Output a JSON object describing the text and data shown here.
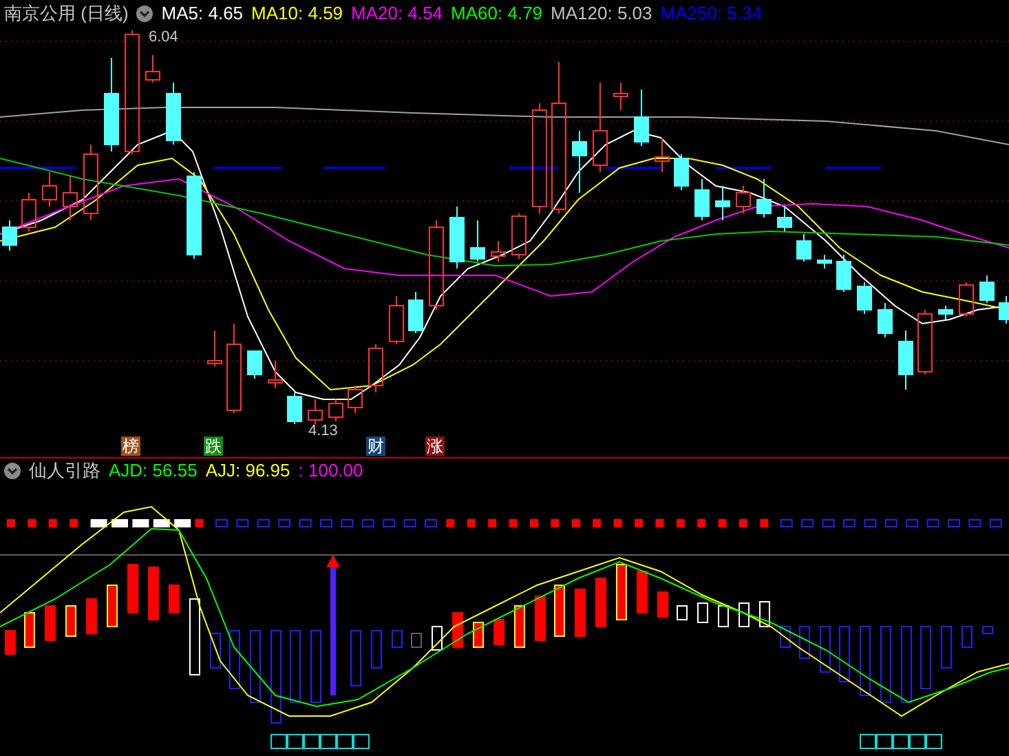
{
  "title": "南京公用 (日线)",
  "ma_legend": [
    {
      "label": "MA5: 4.65",
      "color": "#ffffff"
    },
    {
      "label": "MA10: 4.59",
      "color": "#ffff00"
    },
    {
      "label": "MA20: 4.54",
      "color": "#ff00ff"
    },
    {
      "label": "MA60: 4.79",
      "color": "#00ff00"
    },
    {
      "label": "MA120: 5.03",
      "color": "#c0c0c0"
    },
    {
      "label": "MA250: 5.34",
      "color": "#0000ff"
    }
  ],
  "price_labels": [
    {
      "kind": "high",
      "text": "6.04"
    },
    {
      "kind": "low",
      "text": "4.13"
    }
  ],
  "event_markers": [
    {
      "text": "榜",
      "color": "#a0521a"
    },
    {
      "text": "跌",
      "color": "#148c14"
    },
    {
      "text": "财",
      "color": "#14467d"
    },
    {
      "text": "涨",
      "color": "#8c1010"
    }
  ],
  "indicator": {
    "title": "仙人引路",
    "values": [
      {
        "label": "AJD: 56.55",
        "color": "#00ff00"
      },
      {
        "label": "AJJ: 96.95",
        "color": "#ffff00"
      },
      {
        "label": ": 100.00",
        "color": "#ff00ff"
      }
    ]
  }
}
